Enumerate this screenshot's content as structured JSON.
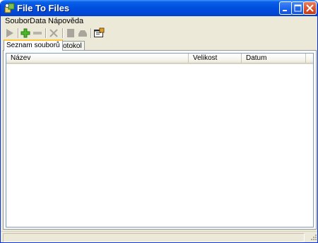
{
  "window": {
    "title": "File To Files",
    "icon": "app-icon",
    "controls": [
      "minimize-icon",
      "maximize-icon",
      "close-icon"
    ],
    "colors": {
      "titlebar": "#0050e0",
      "close": "#d84e2a",
      "face": "#ece9d8"
    }
  },
  "menu": {
    "items": [
      {
        "label": "Soubor"
      },
      {
        "label": "Data"
      },
      {
        "label": "Nápověda"
      }
    ]
  },
  "toolbar": {
    "buttons": [
      {
        "icon": "play-icon",
        "enabled": false
      },
      {
        "icon": "add-icon",
        "enabled": true
      },
      {
        "icon": "remove-icon",
        "enabled": false
      },
      {
        "icon": "delete-icon",
        "enabled": false
      },
      {
        "icon": "document-icon",
        "enabled": false
      },
      {
        "icon": "record-icon",
        "enabled": false
      },
      {
        "icon": "properties-icon",
        "enabled": true
      }
    ]
  },
  "tabs": [
    {
      "label": "Seznam souborů",
      "active": true
    },
    {
      "label": "Protokol",
      "active": false
    }
  ],
  "file_list": {
    "columns": [
      "Název",
      "Velikost",
      "Datum"
    ],
    "rows": []
  },
  "status": {
    "text": ""
  }
}
